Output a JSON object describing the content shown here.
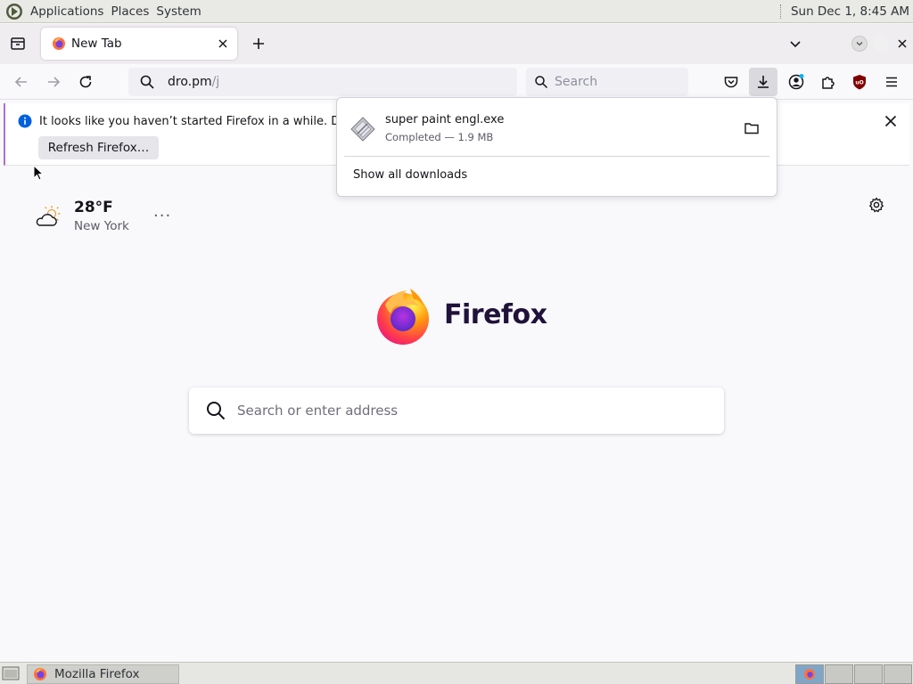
{
  "top_panel": {
    "menus": [
      "Applications",
      "Places",
      "System"
    ],
    "clock": "Sun Dec 1,  8:45 AM"
  },
  "tabs": [
    {
      "title": "New Tab",
      "active": true
    }
  ],
  "nav": {
    "url_host": "dro.pm",
    "url_path": "/j",
    "search_placeholder": "Search"
  },
  "notification": {
    "text": "It looks like you haven’t started Firefox in a while. Do you",
    "button_label": "Refresh Firefox…"
  },
  "downloads": {
    "items": [
      {
        "name": "super paint engl.exe",
        "status": "Completed — 1.9 MB"
      }
    ],
    "show_all_label": "Show all downloads"
  },
  "weather": {
    "temperature": "28°F",
    "city": "New York",
    "more_label": "···"
  },
  "brand": {
    "wordmark": "Firefox"
  },
  "ntp_search": {
    "placeholder": "Search or enter address"
  },
  "taskbar": {
    "window_title": "Mozilla Firefox"
  },
  "colors": {
    "accent": "#0060df",
    "notification_bar": "#b36cd2",
    "ublock": "#800000",
    "active_workspace": "#7fa6c9"
  }
}
